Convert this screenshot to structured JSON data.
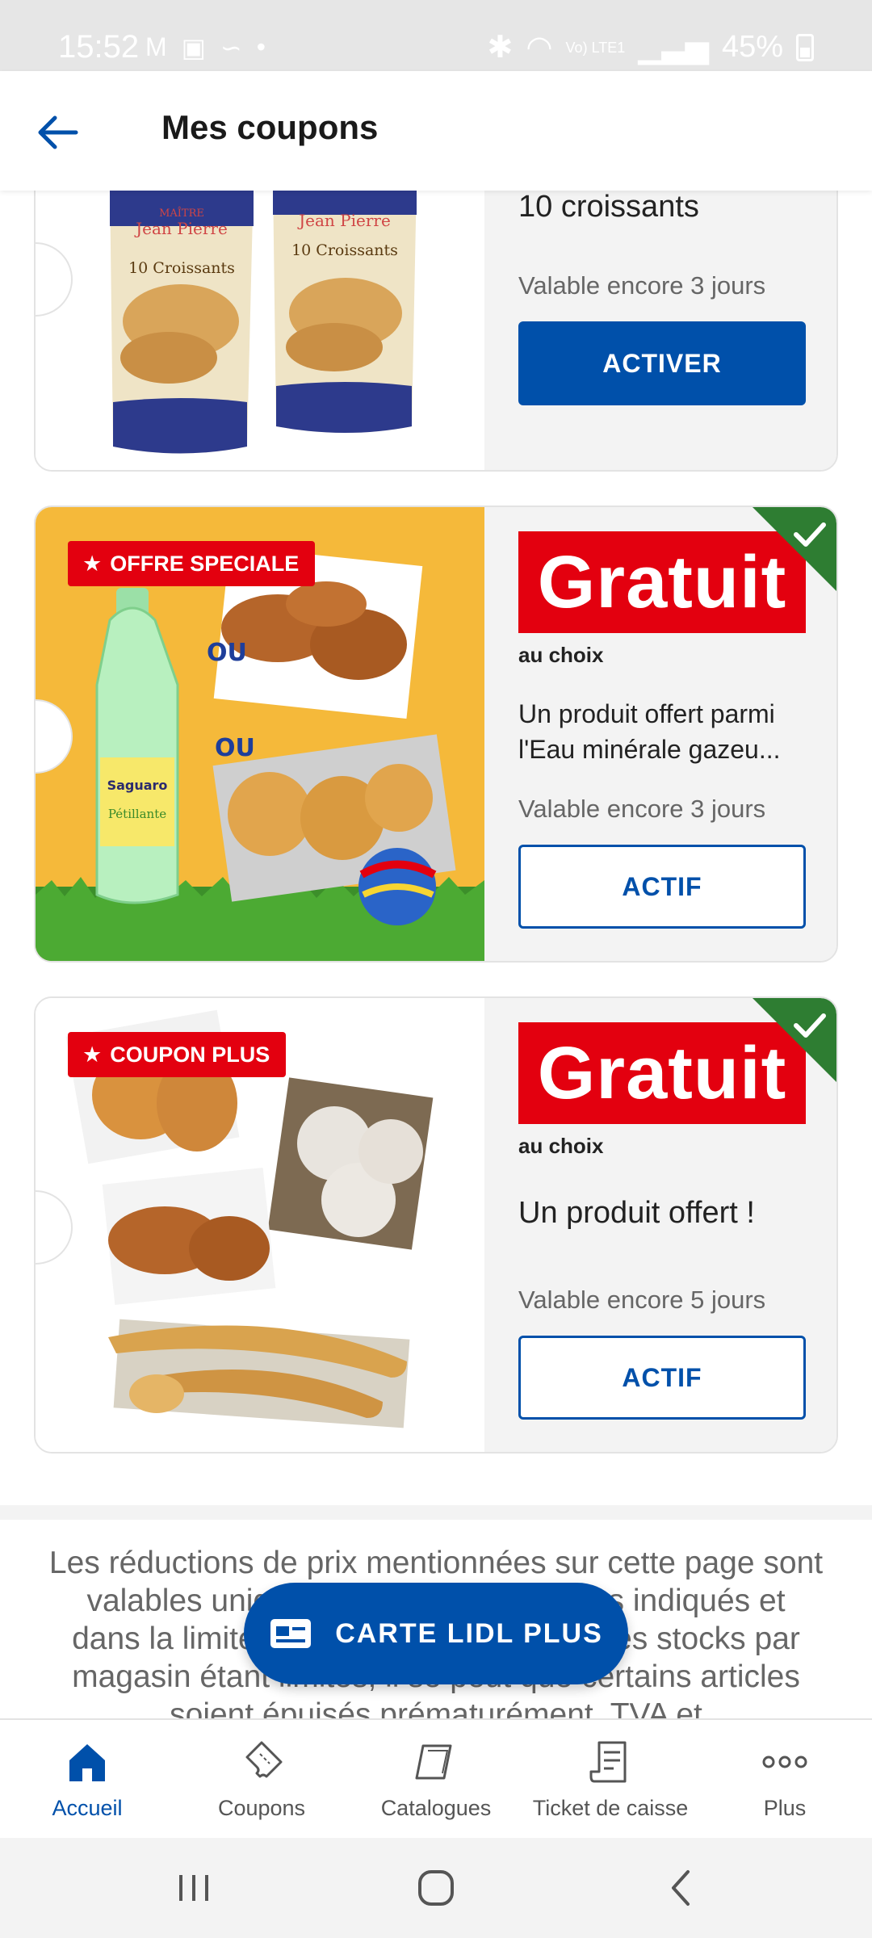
{
  "status_bar": {
    "time": "15:52",
    "battery": "45%",
    "network": "Vo) LTE1"
  },
  "header": {
    "title": "Mes coupons"
  },
  "coupons": [
    {
      "title": "10 croissants",
      "validity": "Valable encore 3 jours",
      "button_label": "ACTIVER",
      "image_labels": {
        "brand": "Jean Pierre",
        "brand_prefix": "MAÎTRE",
        "product": "10 Croissants"
      }
    },
    {
      "badge": "OFFRE SPECIALE",
      "price_label": "Gratuit",
      "sub_label": "au choix",
      "description": "Un produit offert parmi l'Eau minérale gazeu...",
      "validity": "Valable encore 3 jours",
      "button_label": "ACTIF",
      "image_labels": {
        "or1": "OU",
        "or2": "OU",
        "bottle_brand": "Saguaro",
        "bottle_type": "Pétillante"
      }
    },
    {
      "badge": "COUPON PLUS",
      "price_label": "Gratuit",
      "sub_label": "au choix",
      "description": "Un produit offert !",
      "validity": "Valable encore 5 jours",
      "button_label": "ACTIF"
    }
  ],
  "disclaimer": "Les réductions de prix mentionnées sur cette page sont valables uniquement pendant les jours indiqués et dans la limite des stocks disponibles. Les stocks par magasin étant limités, il se peut que certains articles soient épuisés prématurément. TVA et",
  "fab": {
    "label": "CARTE LIDL PLUS"
  },
  "bottom_nav": {
    "items": [
      {
        "label": "Accueil",
        "icon": "home-icon"
      },
      {
        "label": "Coupons",
        "icon": "coupon-icon"
      },
      {
        "label": "Catalogues",
        "icon": "catalogue-icon"
      },
      {
        "label": "Ticket de caisse",
        "icon": "receipt-icon"
      },
      {
        "label": "Plus",
        "icon": "more-icon"
      }
    ]
  },
  "colors": {
    "primary": "#0050aa",
    "red": "#e3000f",
    "active_check": "#2e7d32"
  }
}
